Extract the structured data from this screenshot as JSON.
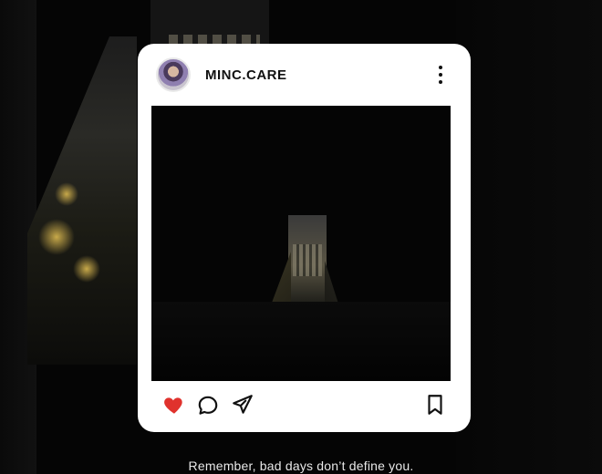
{
  "post": {
    "username": "MINC.CARE",
    "avatar_icon": "profile-avatar",
    "actions": {
      "like_icon": "heart-icon",
      "like_color": "#e0322d",
      "comment_icon": "comment-icon",
      "share_icon": "share-icon",
      "save_icon": "bookmark-icon",
      "more_icon": "more-vertical-icon"
    }
  },
  "caption": "Remember, bad days don’t define you."
}
